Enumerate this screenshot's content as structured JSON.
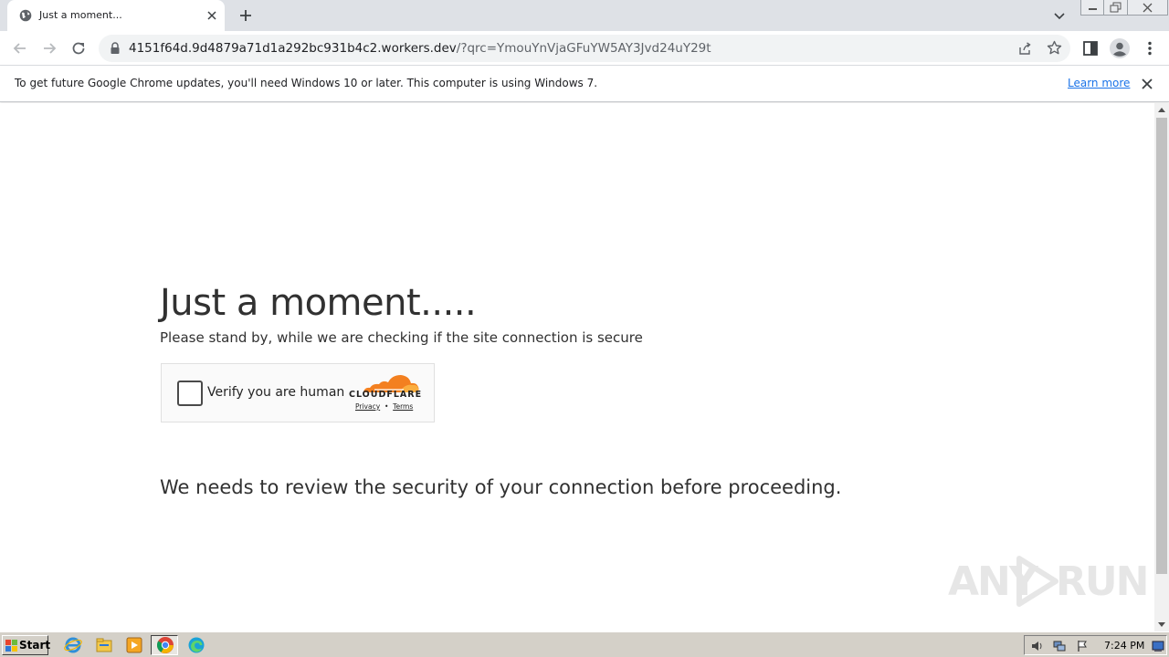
{
  "browser": {
    "tab_title": "Just a moment...",
    "url_host": "4151f64d.9d4879a71d1a292bc931b4c2.workers.dev",
    "url_path": "/?qrc=YmouYnVjaGFuYW5AY3Jvd24uY29t"
  },
  "infobar": {
    "message": "To get future Google Chrome updates, you'll need Windows 10 or later. This computer is using Windows 7.",
    "learn_more": "Learn more"
  },
  "page": {
    "heading": "Just a moment.....",
    "subheading": "Please stand by, while we are checking if the site connection is secure",
    "checkbox_label": "Verify you are human",
    "cf_wordmark": "CLOUDFLARE",
    "cf_privacy": "Privacy",
    "cf_separator": "•",
    "cf_terms": "Terms",
    "review_text": "We needs to review the security of your connection before proceeding."
  },
  "watermark": {
    "left": "ANY",
    "right": "RUN"
  },
  "taskbar": {
    "start_label": "Start",
    "clock": "7:24 PM"
  },
  "colors": {
    "tab_strip": "#dee1e6",
    "link": "#1a73e8",
    "cloudflare_orange": "#f38020",
    "taskbar": "#d4d0c8"
  }
}
